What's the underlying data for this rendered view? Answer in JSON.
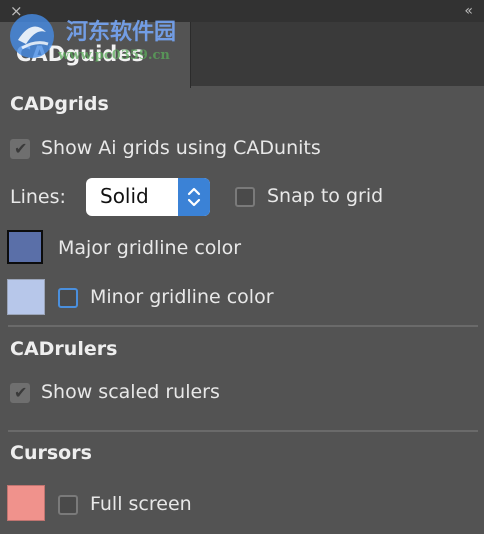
{
  "window": {
    "close_glyph": "×",
    "collapse_glyph": "«"
  },
  "tab": {
    "label": "CADguides"
  },
  "watermark": {
    "text": "河东软件园",
    "url": "www.pc0359.cn"
  },
  "cadgrids": {
    "title": "CADgrids",
    "show_grids": {
      "label": "Show Ai grids using CADunits",
      "checked": true
    },
    "lines_label": "Lines:",
    "lines_value": "Solid",
    "snap": {
      "label": "Snap to grid",
      "checked": false
    },
    "major": {
      "label": "Major gridline color",
      "color": "#5a6fa8"
    },
    "minor": {
      "label": "Minor gridline color",
      "color": "#b7c7ea",
      "checked": false
    }
  },
  "cadrulers": {
    "title": "CADrulers",
    "show_scaled": {
      "label": "Show scaled rulers",
      "checked": true
    }
  },
  "cursors": {
    "title": "Cursors",
    "full_screen": {
      "label": "Full screen",
      "checked": false,
      "color": "#f0928c"
    }
  }
}
